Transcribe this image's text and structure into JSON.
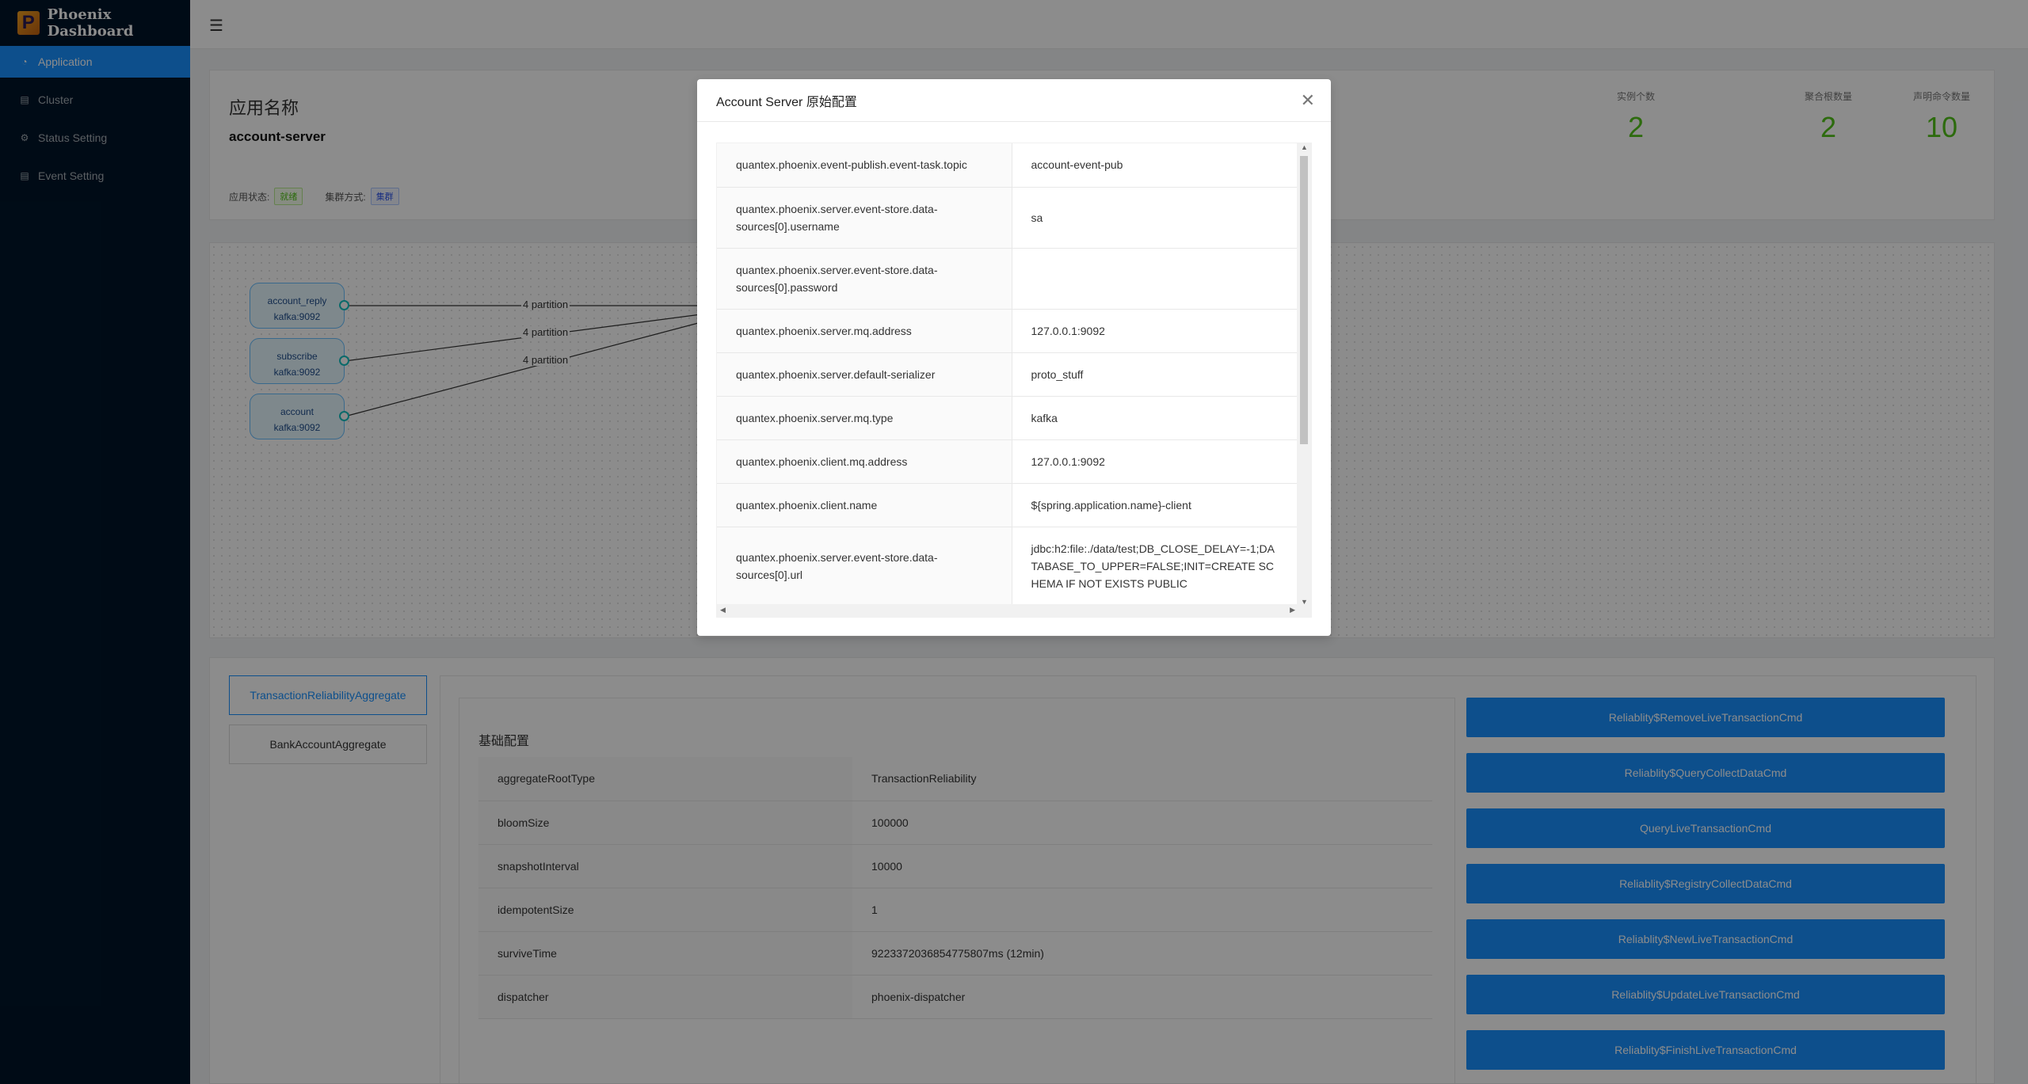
{
  "app": {
    "logo_letter": "P",
    "title": "Phoenix Dashboard"
  },
  "sidebar": {
    "items": [
      {
        "label": "Application",
        "icon": "dashboard-icon",
        "active": true
      },
      {
        "label": "Cluster",
        "icon": "file-icon"
      },
      {
        "label": "Status Setting",
        "icon": "setting-icon"
      },
      {
        "label": "Event Setting",
        "icon": "file-icon"
      }
    ]
  },
  "app_info": {
    "title": "应用名称",
    "name": "account-server",
    "status_label": "应用状态:",
    "status_value": "就绪",
    "cluster_label": "集群方式:",
    "cluster_value": "集群",
    "stats": [
      {
        "label": "实例个数",
        "value": "2"
      },
      {
        "label": "聚合根数量",
        "value": "2"
      },
      {
        "label": "声明命令数量",
        "value": "10"
      }
    ]
  },
  "graph": {
    "nodes": [
      {
        "name": "account_reply",
        "host": "kafka:9092"
      },
      {
        "name": "subscribe",
        "host": "kafka:9092"
      },
      {
        "name": "account",
        "host": "kafka:9092"
      }
    ],
    "edge_labels": [
      "4 partition",
      "4 partition",
      "4 partition"
    ]
  },
  "aggregates": {
    "tabs": [
      "TransactionReliabilityAggregate",
      "BankAccountAggregate"
    ],
    "config_title": "基础配置",
    "config": [
      {
        "key": "aggregateRootType",
        "value": "TransactionReliability"
      },
      {
        "key": "bloomSize",
        "value": "100000"
      },
      {
        "key": "snapshotInterval",
        "value": "10000"
      },
      {
        "key": "idempotentSize",
        "value": "1"
      },
      {
        "key": "surviveTime",
        "value": "9223372036854775807ms (12min)"
      },
      {
        "key": "dispatcher",
        "value": "phoenix-dispatcher"
      }
    ],
    "commands": [
      "Reliablity$RemoveLiveTransactionCmd",
      "Reliablity$QueryCollectDataCmd",
      "QueryLiveTransactionCmd",
      "Reliablity$RegistryCollectDataCmd",
      "Reliablity$NewLiveTransactionCmd",
      "Reliablity$UpdateLiveTransactionCmd",
      "Reliablity$FinishLiveTransactionCmd"
    ]
  },
  "modal": {
    "title": "Account Server 原始配置",
    "rows": [
      {
        "key": "quantex.phoenix.event-publish.event-task.topic",
        "value": "account-event-pub"
      },
      {
        "key": "quantex.phoenix.server.event-store.data-sources[0].username",
        "value": "sa"
      },
      {
        "key": "quantex.phoenix.server.event-store.data-sources[0].password",
        "value": ""
      },
      {
        "key": "quantex.phoenix.server.mq.address",
        "value": "127.0.0.1:9092"
      },
      {
        "key": "quantex.phoenix.server.default-serializer",
        "value": "proto_stuff"
      },
      {
        "key": "quantex.phoenix.server.mq.type",
        "value": "kafka"
      },
      {
        "key": "quantex.phoenix.client.mq.address",
        "value": "127.0.0.1:9092"
      },
      {
        "key": "quantex.phoenix.client.name",
        "value": "${spring.application.name}-client"
      },
      {
        "key": "quantex.phoenix.server.event-store.data-sources[0].url",
        "value": "jdbc:h2:file:./data/test;DB_CLOSE_DELAY=-1;DATABASE_TO_UPPER=FALSE;INIT=CREATE SCHEMA IF NOT EXISTS PUBLIC"
      }
    ]
  }
}
